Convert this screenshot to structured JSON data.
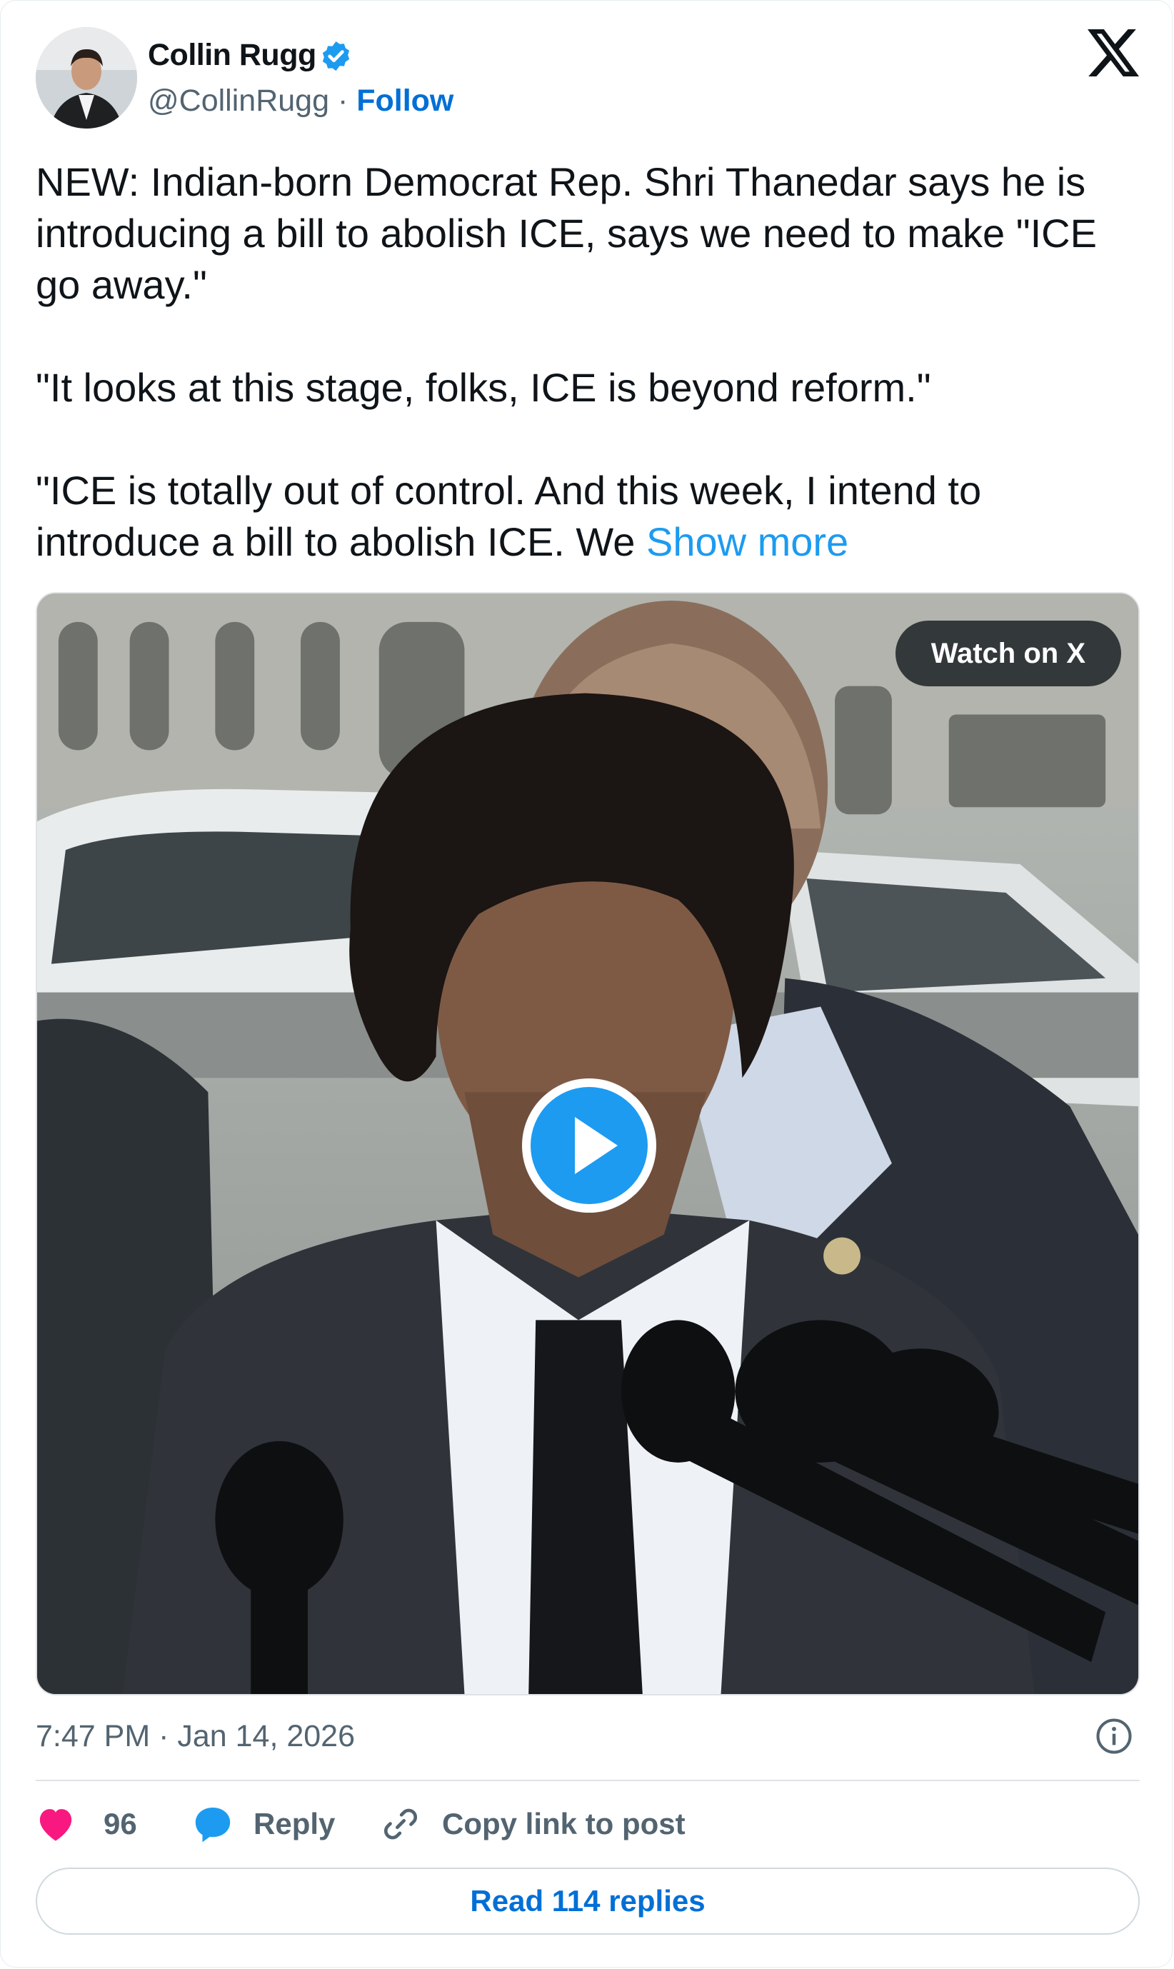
{
  "author": {
    "name": "Collin Rugg",
    "handle": "@CollinRugg",
    "separator": "·",
    "follow_label": "Follow",
    "verified_color": "#1d9bf0"
  },
  "tweet": {
    "paragraphs": [
      "NEW: Indian-born Democrat Rep. Shri Thanedar says he is introducing a bill to abolish ICE, says we need to make \"ICE go away.\"",
      "\"It looks at this stage, folks, ICE is beyond reform.\"",
      "\"ICE is totally out of control. And this week, I intend to introduce a bill to abolish ICE. We"
    ],
    "show_more": "Show more"
  },
  "media": {
    "watch_label": "Watch on X",
    "play_icon": "play-icon"
  },
  "footer": {
    "timestamp": "7:47 PM · Jan 14, 2026",
    "likes": "96",
    "reply_label": "Reply",
    "copy_label": "Copy link to post",
    "read_replies": "Read 114 replies"
  },
  "colors": {
    "heart": "#f91880",
    "reply": "#1d9bf0",
    "link": "#006fd6",
    "muted": "#536471"
  }
}
